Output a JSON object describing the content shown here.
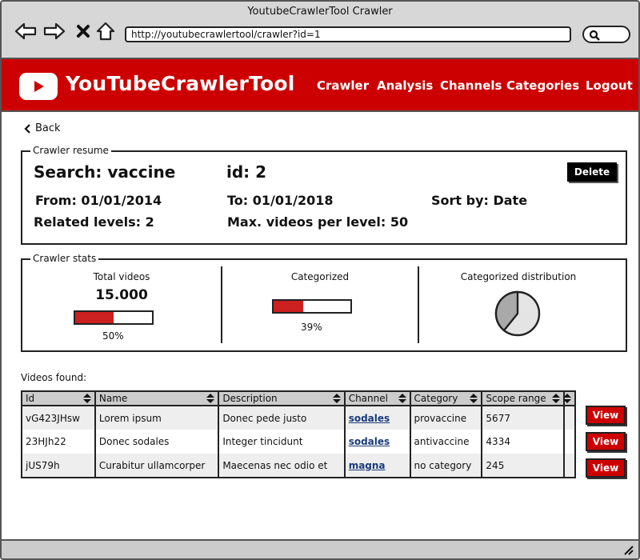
{
  "browser": {
    "window_title": "YoutubeCrawlerTool Crawler",
    "url": "http://youtubecrawlertool/crawler?id=1"
  },
  "header": {
    "brand": "YouTubeCrawlerTool",
    "nav": [
      "Crawler",
      "Analysis",
      "Channels",
      "Categories",
      "Logout"
    ],
    "accent": "#cc0000"
  },
  "back_label": "Back",
  "resume": {
    "legend": "Crawler resume",
    "search": "Search: vaccine",
    "id": "id: 2",
    "from": "From: 01/01/2014",
    "to": "To: 01/01/2018",
    "sort": "Sort by: Date",
    "levels": "Related levels: 2",
    "max_videos": "Max. videos per level: 50",
    "delete_label": "Delete"
  },
  "stats": {
    "legend": "Crawler stats",
    "total_label": "Total videos",
    "total_value": "15.000",
    "total_pct": "50%",
    "total_fraction": 0.5,
    "categorized_label": "Categorized",
    "categorized_pct": "39%",
    "categorized_fraction": 0.39,
    "distribution_label": "Categorized distribution"
  },
  "videos": {
    "label": "Videos found:",
    "columns": [
      "Id",
      "Name",
      "Description",
      "Channel",
      "Category",
      "Scope range",
      ""
    ],
    "rows": [
      [
        "vG423JHsw",
        "Lorem ipsum",
        "Donec pede justo",
        "sodales",
        "provaccine",
        "5677"
      ],
      [
        "23HJh22",
        "Donec sodales",
        "Integer tincidunt",
        "sodales",
        "antivaccine",
        "4334"
      ],
      [
        "jUS79h",
        "Curabitur ullamcorper",
        "Maecenas nec odio et",
        "magna",
        "no category",
        "245"
      ]
    ],
    "view_label": "View"
  }
}
